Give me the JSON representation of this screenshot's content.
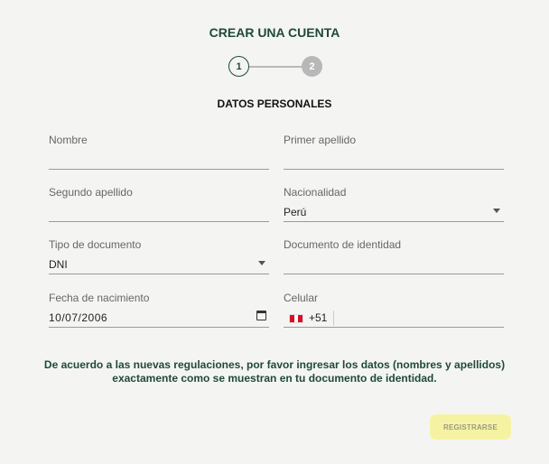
{
  "header": {
    "title": "CREAR UNA CUENTA",
    "steps": [
      "1",
      "2"
    ],
    "active_step": 1
  },
  "section": {
    "title": "DATOS PERSONALES"
  },
  "fields": {
    "nombre": {
      "label": "Nombre",
      "value": ""
    },
    "primer_apellido": {
      "label": "Primer apellido",
      "value": ""
    },
    "segundo_apellido": {
      "label": "Segundo apellido",
      "value": ""
    },
    "nacionalidad": {
      "label": "Nacionalidad",
      "value": "Perú"
    },
    "tipo_documento": {
      "label": "Tipo de documento",
      "value": "DNI"
    },
    "documento_identidad": {
      "label": "Documento de identidad",
      "value": ""
    },
    "fecha_nacimiento": {
      "label": "Fecha de nacimiento",
      "value": "10/07/2006"
    },
    "celular": {
      "label": "Celular",
      "dial_code": "+51",
      "value": ""
    }
  },
  "notice": "De acuerdo a las nuevas regulaciones, por favor ingresar los datos (nombres y apellidos) exactamente como se muestran en tu documento de identidad.",
  "actions": {
    "register_label": "REGISTRARSE"
  },
  "colors": {
    "primary": "#1f4a36",
    "button_bg": "#f5f3a2",
    "step_inactive": "#b8b8b8"
  }
}
